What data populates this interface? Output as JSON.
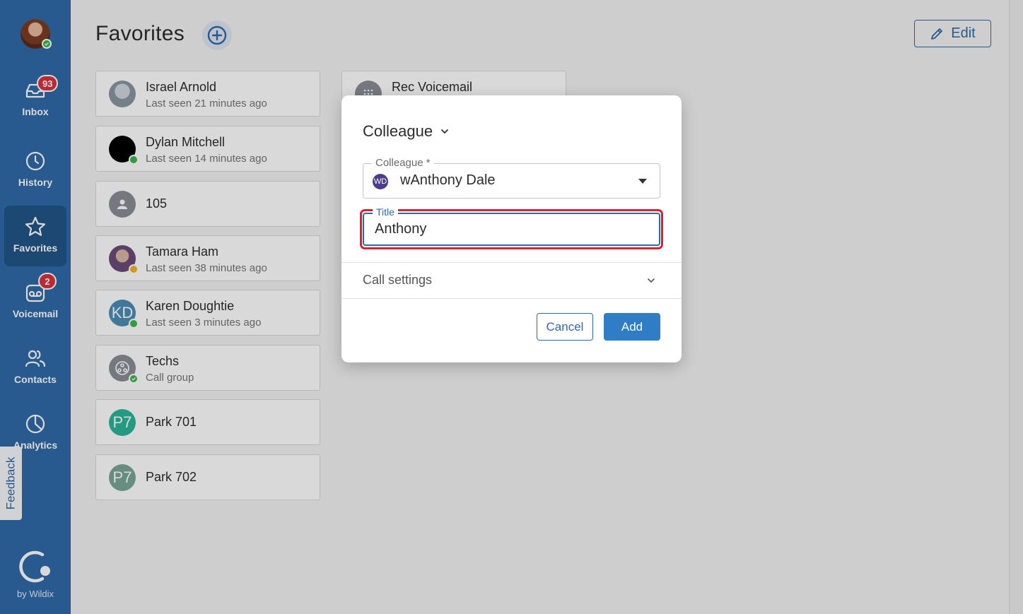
{
  "sidebar": {
    "items": [
      {
        "label": "Inbox",
        "badge": "93",
        "icon": "inbox-icon"
      },
      {
        "label": "History",
        "icon": "clock-icon"
      },
      {
        "label": "Favorites",
        "icon": "star-icon",
        "active": true
      },
      {
        "label": "Voicemail",
        "badge": "2",
        "icon": "voicemail-icon"
      },
      {
        "label": "Contacts",
        "icon": "contacts-icon"
      },
      {
        "label": "Analytics",
        "icon": "pie-chart-icon"
      }
    ],
    "feedback_label": "Feedback",
    "brand_text": "by Wildix"
  },
  "header": {
    "title": "Favorites",
    "edit_label": "Edit"
  },
  "favorites": [
    {
      "name": "Israel Arnold",
      "sub": "Last seen 21 minutes ago"
    },
    {
      "name": "Dylan Mitchell",
      "sub": "Last seen 14 minutes ago"
    },
    {
      "name": "105",
      "sub": ""
    },
    {
      "name": "Tamara Ham",
      "sub": "Last seen 38 minutes ago"
    },
    {
      "name": "Karen Doughtie",
      "sub": "Last seen 3 minutes ago",
      "initials": "KD"
    },
    {
      "name": "Techs",
      "sub": "Call group"
    },
    {
      "name": "Park 701",
      "sub": "",
      "initials": "P7"
    },
    {
      "name": "Park 702",
      "sub": "",
      "initials": "P7"
    },
    {
      "name": "Rec Voicemail",
      "sub": ""
    }
  ],
  "dialog": {
    "type_label": "Colleague",
    "colleague_field": {
      "label": "Colleague *",
      "value": "wAnthony Dale",
      "initials": "WD"
    },
    "title_field": {
      "label": "Title",
      "value": "Anthony"
    },
    "call_settings_label": "Call settings",
    "cancel_label": "Cancel",
    "add_label": "Add"
  },
  "colors": {
    "sidebar": "#2f6aa8",
    "accent": "#2f7dc4",
    "badge": "#d9333f",
    "highlight": "#d8222f"
  }
}
